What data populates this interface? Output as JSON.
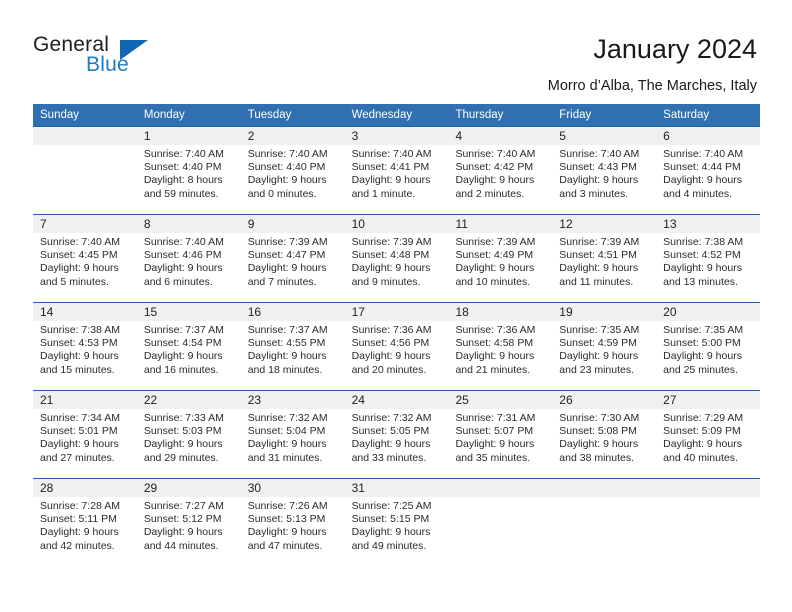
{
  "brand": {
    "name_part1": "General",
    "name_part2": "Blue",
    "logo_icon": "blue-triangle"
  },
  "header": {
    "title": "January 2024",
    "subtitle": "Morro d’Alba, The Marches, Italy"
  },
  "calendar": {
    "weekdays": [
      "Sunday",
      "Monday",
      "Tuesday",
      "Wednesday",
      "Thursday",
      "Friday",
      "Saturday"
    ],
    "accent_color": "#3070b0",
    "separator_color": "#1f62a8",
    "daynum_band_color": "#f0f0f0",
    "weeks": [
      {
        "days": [
          {
            "num": "",
            "sunrise": "",
            "sunset": "",
            "daylight_line1": "",
            "daylight_line2": ""
          },
          {
            "num": "1",
            "sunrise": "Sunrise: 7:40 AM",
            "sunset": "Sunset: 4:40 PM",
            "daylight_line1": "Daylight: 8 hours",
            "daylight_line2": "and 59 minutes."
          },
          {
            "num": "2",
            "sunrise": "Sunrise: 7:40 AM",
            "sunset": "Sunset: 4:40 PM",
            "daylight_line1": "Daylight: 9 hours",
            "daylight_line2": "and 0 minutes."
          },
          {
            "num": "3",
            "sunrise": "Sunrise: 7:40 AM",
            "sunset": "Sunset: 4:41 PM",
            "daylight_line1": "Daylight: 9 hours",
            "daylight_line2": "and 1 minute."
          },
          {
            "num": "4",
            "sunrise": "Sunrise: 7:40 AM",
            "sunset": "Sunset: 4:42 PM",
            "daylight_line1": "Daylight: 9 hours",
            "daylight_line2": "and 2 minutes."
          },
          {
            "num": "5",
            "sunrise": "Sunrise: 7:40 AM",
            "sunset": "Sunset: 4:43 PM",
            "daylight_line1": "Daylight: 9 hours",
            "daylight_line2": "and 3 minutes."
          },
          {
            "num": "6",
            "sunrise": "Sunrise: 7:40 AM",
            "sunset": "Sunset: 4:44 PM",
            "daylight_line1": "Daylight: 9 hours",
            "daylight_line2": "and 4 minutes."
          }
        ]
      },
      {
        "days": [
          {
            "num": "7",
            "sunrise": "Sunrise: 7:40 AM",
            "sunset": "Sunset: 4:45 PM",
            "daylight_line1": "Daylight: 9 hours",
            "daylight_line2": "and 5 minutes."
          },
          {
            "num": "8",
            "sunrise": "Sunrise: 7:40 AM",
            "sunset": "Sunset: 4:46 PM",
            "daylight_line1": "Daylight: 9 hours",
            "daylight_line2": "and 6 minutes."
          },
          {
            "num": "9",
            "sunrise": "Sunrise: 7:39 AM",
            "sunset": "Sunset: 4:47 PM",
            "daylight_line1": "Daylight: 9 hours",
            "daylight_line2": "and 7 minutes."
          },
          {
            "num": "10",
            "sunrise": "Sunrise: 7:39 AM",
            "sunset": "Sunset: 4:48 PM",
            "daylight_line1": "Daylight: 9 hours",
            "daylight_line2": "and 9 minutes."
          },
          {
            "num": "11",
            "sunrise": "Sunrise: 7:39 AM",
            "sunset": "Sunset: 4:49 PM",
            "daylight_line1": "Daylight: 9 hours",
            "daylight_line2": "and 10 minutes."
          },
          {
            "num": "12",
            "sunrise": "Sunrise: 7:39 AM",
            "sunset": "Sunset: 4:51 PM",
            "daylight_line1": "Daylight: 9 hours",
            "daylight_line2": "and 11 minutes."
          },
          {
            "num": "13",
            "sunrise": "Sunrise: 7:38 AM",
            "sunset": "Sunset: 4:52 PM",
            "daylight_line1": "Daylight: 9 hours",
            "daylight_line2": "and 13 minutes."
          }
        ]
      },
      {
        "days": [
          {
            "num": "14",
            "sunrise": "Sunrise: 7:38 AM",
            "sunset": "Sunset: 4:53 PM",
            "daylight_line1": "Daylight: 9 hours",
            "daylight_line2": "and 15 minutes."
          },
          {
            "num": "15",
            "sunrise": "Sunrise: 7:37 AM",
            "sunset": "Sunset: 4:54 PM",
            "daylight_line1": "Daylight: 9 hours",
            "daylight_line2": "and 16 minutes."
          },
          {
            "num": "16",
            "sunrise": "Sunrise: 7:37 AM",
            "sunset": "Sunset: 4:55 PM",
            "daylight_line1": "Daylight: 9 hours",
            "daylight_line2": "and 18 minutes."
          },
          {
            "num": "17",
            "sunrise": "Sunrise: 7:36 AM",
            "sunset": "Sunset: 4:56 PM",
            "daylight_line1": "Daylight: 9 hours",
            "daylight_line2": "and 20 minutes."
          },
          {
            "num": "18",
            "sunrise": "Sunrise: 7:36 AM",
            "sunset": "Sunset: 4:58 PM",
            "daylight_line1": "Daylight: 9 hours",
            "daylight_line2": "and 21 minutes."
          },
          {
            "num": "19",
            "sunrise": "Sunrise: 7:35 AM",
            "sunset": "Sunset: 4:59 PM",
            "daylight_line1": "Daylight: 9 hours",
            "daylight_line2": "and 23 minutes."
          },
          {
            "num": "20",
            "sunrise": "Sunrise: 7:35 AM",
            "sunset": "Sunset: 5:00 PM",
            "daylight_line1": "Daylight: 9 hours",
            "daylight_line2": "and 25 minutes."
          }
        ]
      },
      {
        "days": [
          {
            "num": "21",
            "sunrise": "Sunrise: 7:34 AM",
            "sunset": "Sunset: 5:01 PM",
            "daylight_line1": "Daylight: 9 hours",
            "daylight_line2": "and 27 minutes."
          },
          {
            "num": "22",
            "sunrise": "Sunrise: 7:33 AM",
            "sunset": "Sunset: 5:03 PM",
            "daylight_line1": "Daylight: 9 hours",
            "daylight_line2": "and 29 minutes."
          },
          {
            "num": "23",
            "sunrise": "Sunrise: 7:32 AM",
            "sunset": "Sunset: 5:04 PM",
            "daylight_line1": "Daylight: 9 hours",
            "daylight_line2": "and 31 minutes."
          },
          {
            "num": "24",
            "sunrise": "Sunrise: 7:32 AM",
            "sunset": "Sunset: 5:05 PM",
            "daylight_line1": "Daylight: 9 hours",
            "daylight_line2": "and 33 minutes."
          },
          {
            "num": "25",
            "sunrise": "Sunrise: 7:31 AM",
            "sunset": "Sunset: 5:07 PM",
            "daylight_line1": "Daylight: 9 hours",
            "daylight_line2": "and 35 minutes."
          },
          {
            "num": "26",
            "sunrise": "Sunrise: 7:30 AM",
            "sunset": "Sunset: 5:08 PM",
            "daylight_line1": "Daylight: 9 hours",
            "daylight_line2": "and 38 minutes."
          },
          {
            "num": "27",
            "sunrise": "Sunrise: 7:29 AM",
            "sunset": "Sunset: 5:09 PM",
            "daylight_line1": "Daylight: 9 hours",
            "daylight_line2": "and 40 minutes."
          }
        ]
      },
      {
        "days": [
          {
            "num": "28",
            "sunrise": "Sunrise: 7:28 AM",
            "sunset": "Sunset: 5:11 PM",
            "daylight_line1": "Daylight: 9 hours",
            "daylight_line2": "and 42 minutes."
          },
          {
            "num": "29",
            "sunrise": "Sunrise: 7:27 AM",
            "sunset": "Sunset: 5:12 PM",
            "daylight_line1": "Daylight: 9 hours",
            "daylight_line2": "and 44 minutes."
          },
          {
            "num": "30",
            "sunrise": "Sunrise: 7:26 AM",
            "sunset": "Sunset: 5:13 PM",
            "daylight_line1": "Daylight: 9 hours",
            "daylight_line2": "and 47 minutes."
          },
          {
            "num": "31",
            "sunrise": "Sunrise: 7:25 AM",
            "sunset": "Sunset: 5:15 PM",
            "daylight_line1": "Daylight: 9 hours",
            "daylight_line2": "and 49 minutes."
          },
          {
            "num": "",
            "sunrise": "",
            "sunset": "",
            "daylight_line1": "",
            "daylight_line2": ""
          },
          {
            "num": "",
            "sunrise": "",
            "sunset": "",
            "daylight_line1": "",
            "daylight_line2": ""
          },
          {
            "num": "",
            "sunrise": "",
            "sunset": "",
            "daylight_line1": "",
            "daylight_line2": ""
          }
        ]
      }
    ]
  }
}
